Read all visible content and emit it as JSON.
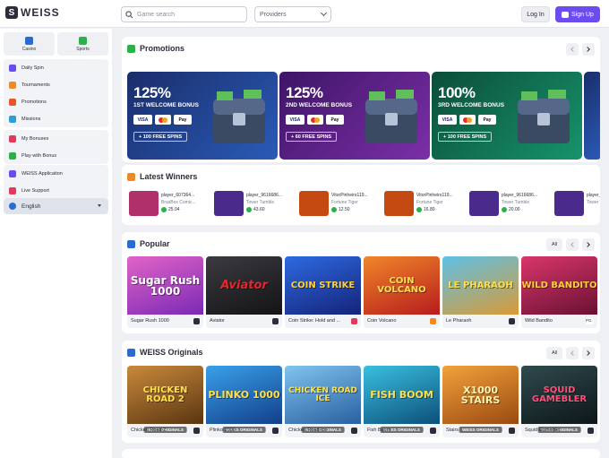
{
  "header": {
    "logo_text": "WEISS",
    "search_placeholder": "Game search",
    "providers_label": "Providers",
    "login_label": "Log In",
    "signup_label": "Sign Up"
  },
  "sidebar": {
    "categories": [
      {
        "label": "Casino",
        "color": "#2a6bd1"
      },
      {
        "label": "Sports",
        "color": "#2ab14a"
      }
    ],
    "group1": [
      "Daily Spin",
      "Tournaments",
      "Promotions",
      "Missions"
    ],
    "group2": [
      "My Bonuses",
      "Play with Bonus"
    ],
    "group3": [
      "WEISS Application",
      "Live Support"
    ],
    "language": "English"
  },
  "promotions": {
    "title": "Promotions",
    "cards": [
      {
        "percent": "125%",
        "title": "1ST WELCOME BONUS",
        "spins": "+ 100 FREE SPINS",
        "bg": "#1d3f86"
      },
      {
        "percent": "125%",
        "title": "2ND WELCOME BONUS",
        "spins": "+ 60 FREE SPINS",
        "bg": "#5b1d86"
      },
      {
        "percent": "100%",
        "title": "3RD WELCOME BONUS",
        "spins": "+ 100 FREE SPINS",
        "bg": "#0e6f52"
      }
    ],
    "pay_visa": "VISA",
    "pay_apple": "Pay"
  },
  "winners": {
    "title": "Latest Winners",
    "items": [
      {
        "player": "player_607364...",
        "game": "BrasBox Comic...",
        "amount": "25.04",
        "color": "#b0306a"
      },
      {
        "player": "player_9616686...",
        "game": "Tower Tumble",
        "amount": "43.60",
        "color": "#4a2a8a"
      },
      {
        "player": "VitorPinheiro119...",
        "game": "Fortune Tiger",
        "amount": "12.50",
        "color": "#c44a12"
      },
      {
        "player": "VitorPinheiro119...",
        "game": "Fortune Tiger",
        "amount": "16.80",
        "color": "#c44a12"
      },
      {
        "player": "player_9616686...",
        "game": "Tower Tumble",
        "amount": "20.00",
        "color": "#4a2a8a"
      },
      {
        "player": "player_9616686...",
        "game": "Tower Tumble",
        "amount": "",
        "color": "#4a2a8a"
      }
    ]
  },
  "popular": {
    "title": "Popular",
    "all_label": "All",
    "games": [
      {
        "name": "Sugar Rush 1000",
        "art": "Sugar Rush 1000",
        "bg": "#b13ad6"
      },
      {
        "name": "Aviator",
        "art": "Aviator",
        "bg": "#2a2a2e"
      },
      {
        "name": "Coin Strike: Hold and ...",
        "art": "COIN STRIKE",
        "bg": "#1f3fb5"
      },
      {
        "name": "Coin Volcano",
        "art": "COIN VOLCANO",
        "bg": "#c2410c"
      },
      {
        "name": "Le Pharaoh",
        "art": "LE PHARAOH",
        "bg": "#2d8fb8"
      },
      {
        "name": "Wild Bandito",
        "art": "WILD BANDITO",
        "bg": "#a4224f"
      }
    ]
  },
  "originals": {
    "title": "WEISS Originals",
    "all_label": "All",
    "tag": "WEISS ORIGINALS",
    "games": [
      {
        "name": "Chicken Road 2",
        "art": "CHICKEN ROAD 2",
        "bg": "#7a4a1c"
      },
      {
        "name": "Plinko 1000",
        "art": "PLINKO 1000",
        "bg": "#1f6fc4"
      },
      {
        "name": "Chicken Road Ice",
        "art": "CHICKEN ROAD ICE",
        "bg": "#3a86c8"
      },
      {
        "name": "Fish Boom",
        "art": "FISH BOOM",
        "bg": "#1b8fb0"
      },
      {
        "name": "Stairs",
        "art": "X1000 STAIRS",
        "bg": "#c7651a"
      },
      {
        "name": "Squid Gamebler",
        "art": "SQUID GAMEBLER",
        "bg": "#1c2a2e"
      }
    ]
  }
}
